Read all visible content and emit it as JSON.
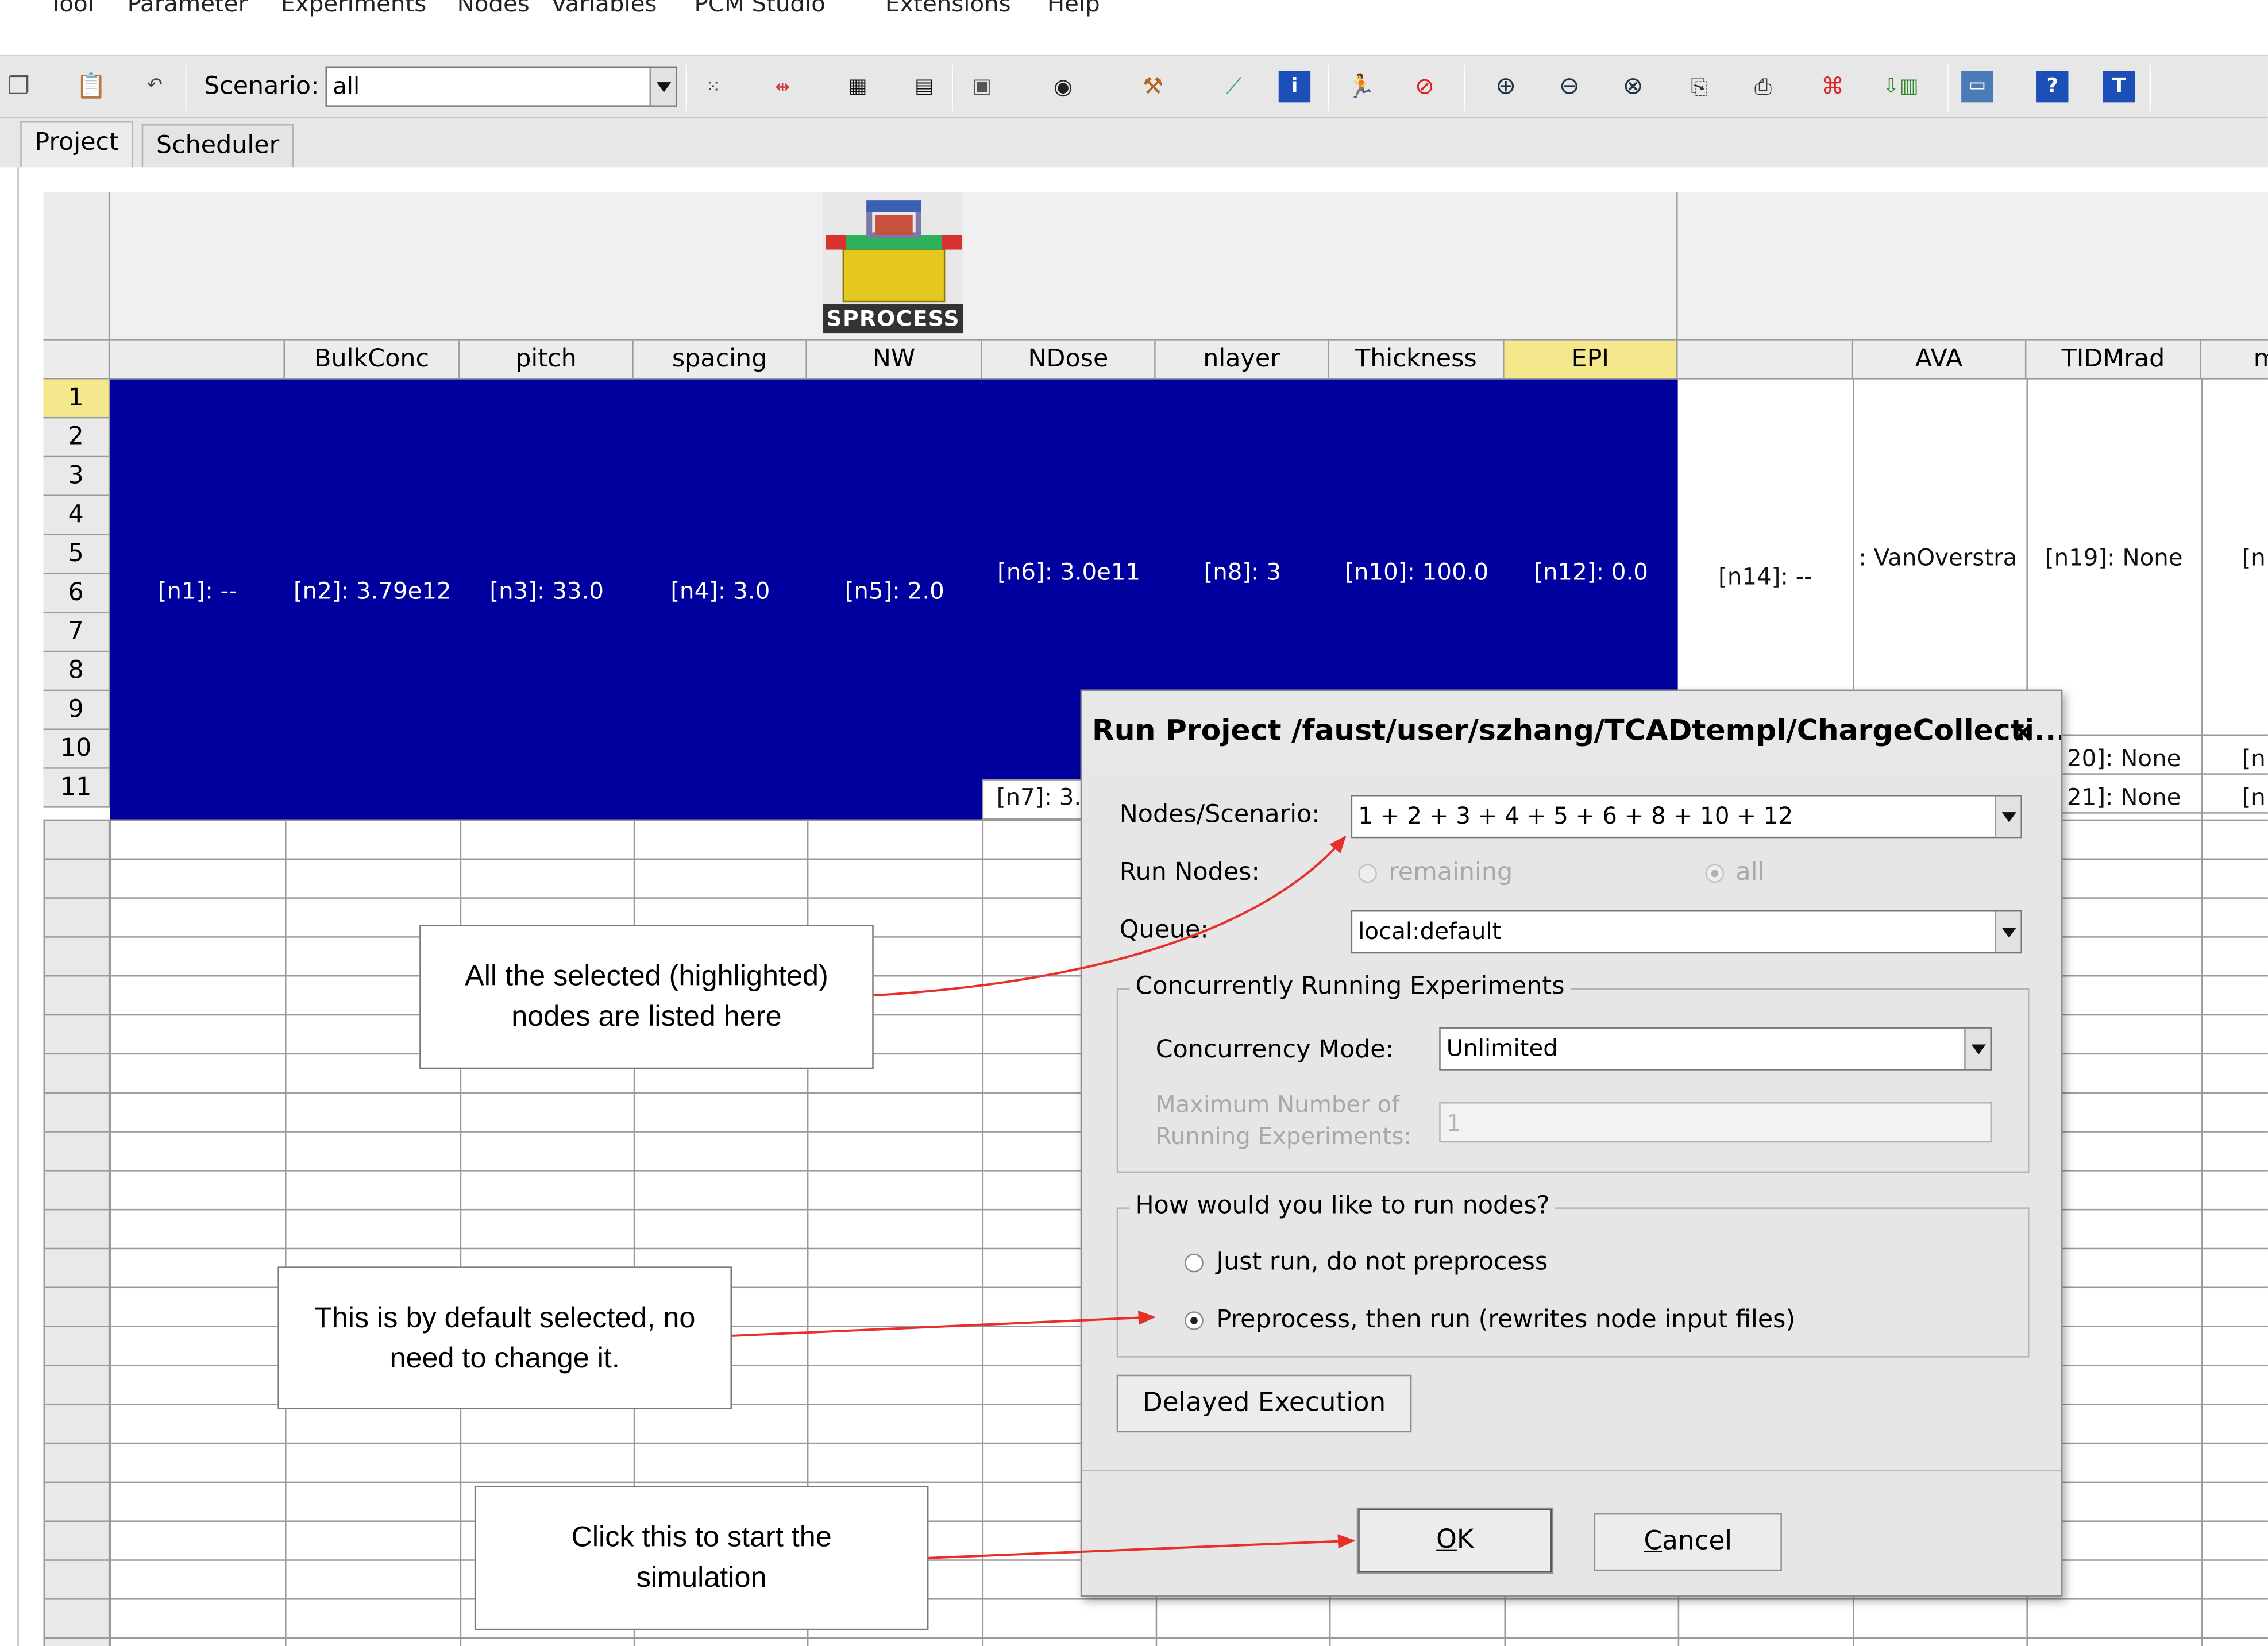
{
  "menubar": {
    "items": [
      "Tool",
      "Parameter",
      "Experiments",
      "Nodes",
      "Variables",
      "PCM Studio",
      "Extensions",
      "Help"
    ]
  },
  "toolbar": {
    "scenario_label": "Scenario:",
    "scenario_value": "all",
    "icons": [
      "copy-icon",
      "paste-icon",
      "undo-icon",
      "split-icon",
      "merge-icon",
      "add-rows-icon",
      "add-cols-icon",
      "layout-icon",
      "view-icon",
      "run-tool-icon",
      "plot-icon",
      "info-icon",
      "run-icon",
      "abort-icon",
      "zoom-in-icon",
      "zoom-out-icon",
      "zoom-reset-icon",
      "export-icon",
      "import-icon",
      "prune-icon",
      "node-list-icon",
      "terminal-icon",
      "help-icon",
      "tutorial-icon"
    ]
  },
  "tabs": [
    "Project",
    "Scheduler"
  ],
  "tool": {
    "name": "SPROCESS"
  },
  "columns": [
    "",
    "BulkConc",
    "pitch",
    "spacing",
    "NW",
    "NDose",
    "nlayer",
    "Thickness",
    "EPI",
    "",
    "AVA",
    "TIDMrad",
    "m"
  ],
  "rows": [
    "1",
    "2",
    "3",
    "4",
    "5",
    "6",
    "7",
    "8",
    "9",
    "10",
    "11"
  ],
  "cells": {
    "n1": "[n1]: --",
    "n2": "[n2]: 3.79e12",
    "n3": "[n3]: 33.0",
    "n4": "[n4]: 3.0",
    "n5": "[n5]: 2.0",
    "n6": "[n6]: 3.0e11",
    "n7": "[n7]: 3.",
    "n8": "[n8]: 3",
    "n10": "[n10]: 100.0",
    "n12": "[n12]: 0.0",
    "n14": "[n14]: --",
    "ava": ": VanOverstra",
    "n19": "[n19]: None",
    "n20": "20]: None",
    "n21": "21]: None",
    "edge_a": "[n",
    "edge_b": "[n",
    "edge_c": "[n"
  },
  "dialog": {
    "title": "Run Project /faust/user/szhang/TCADtempl/ChargeCollecti...",
    "close": "×",
    "nodes_label": "Nodes/Scenario:",
    "nodes_value": "1 + 2 + 3 + 4 + 5 + 6 + 8 + 10 + 12",
    "run_nodes_label": "Run Nodes:",
    "run_remaining": "remaining",
    "run_all": "all",
    "queue_label": "Queue:",
    "queue_value": "local:default",
    "concurrency_group": "Concurrently Running Experiments",
    "concurrency_label": "Concurrency Mode:",
    "concurrency_value": "Unlimited",
    "max_label_1": "Maximum Number of",
    "max_label_2": "Running Experiments:",
    "max_value": "1",
    "run_group": "How would you like to run nodes?",
    "opt_just_run": "Just run, do not preprocess",
    "opt_preprocess": "Preprocess, then run (rewrites node input files)",
    "delayed": "Delayed Execution",
    "ok_mnemonic": "O",
    "ok_rest": "K",
    "cancel_mnemonic": "C",
    "cancel_rest": "ancel"
  },
  "callouts": {
    "nodes_1": "All the selected (highlighted)",
    "nodes_2": "nodes are listed here",
    "default_1": "This is by default selected, no",
    "default_2": "need to change it.",
    "ok_1": "Click this to start the",
    "ok_2": "simulation"
  },
  "colors": {
    "selection": "#00009e",
    "highlight": "#f5e88c",
    "arrow": "#e8302a"
  }
}
